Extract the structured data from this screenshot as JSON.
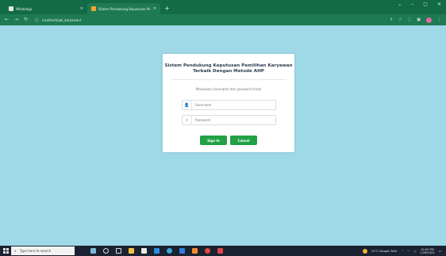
{
  "browser": {
    "tabs": [
      {
        "label": "WhatsApp",
        "active": false
      },
      {
        "label": "Sistem Pendukung Keputusan Pe",
        "active": true
      }
    ],
    "new_tab_glyph": "+",
    "window_controls": [
      "⌄",
      "–",
      "▢",
      "✕"
    ],
    "address": "localhost/spk_karyawan/",
    "nav_glyphs": {
      "back": "←",
      "forward": "→",
      "reload": "↻"
    }
  },
  "login": {
    "title_line1": "Sistem Pendukung Keputusan Pemilihan Karyawan",
    "title_line2": "Terbaik Dengan Metode AHP",
    "subtitle": "Masukkan Username dan password Anda",
    "username_placeholder": "Username",
    "password_placeholder": "Password",
    "signin_label": "Sign In",
    "cancel_label": "Cancel"
  },
  "taskbar": {
    "search_placeholder": "Type here to search",
    "weather": "31°C  Sangat Terik",
    "time": "10:05 PM",
    "date": "1/26/2023"
  },
  "colors": {
    "chrome_bar": "#136b45",
    "page_background": "#9fd8e6",
    "button_green": "#21a045"
  }
}
